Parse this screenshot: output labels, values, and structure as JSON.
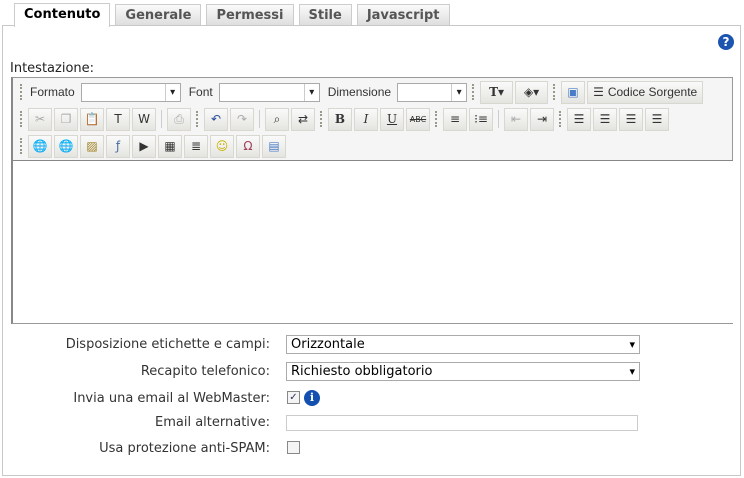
{
  "tabs": [
    {
      "label": "Contenuto",
      "active": true
    },
    {
      "label": "Generale"
    },
    {
      "label": "Permessi"
    },
    {
      "label": "Stile"
    },
    {
      "label": "Javascript"
    }
  ],
  "help_icon": "?",
  "heading": "Intestazione:",
  "toolbar": {
    "format_label": "Formato",
    "font_label": "Font",
    "size_label": "Dimensione",
    "source_label": "Codice Sorgente",
    "bold": "B",
    "italic": "I",
    "underline": "U",
    "strike": "ABC"
  },
  "form": {
    "layout_label": "Disposizione etichette e campi:",
    "layout_value": "Orizzontale",
    "phone_label": "Recapito telefonico:",
    "phone_value": "Richiesto obbligatorio",
    "webmaster_label": "Invia una email al WebMaster:",
    "webmaster_checked": true,
    "alt_email_label": "Email alternative:",
    "alt_email_value": "",
    "antispam_label": "Usa protezione anti-SPAM:",
    "antispam_checked": false,
    "info_icon": "i"
  }
}
